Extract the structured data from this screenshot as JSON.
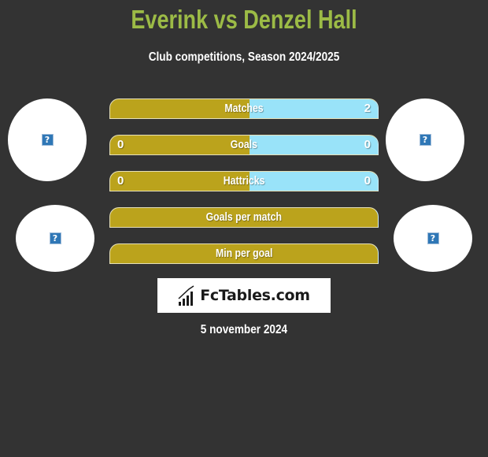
{
  "header": {
    "title": "Everink vs Denzel Hall",
    "subtitle": "Club competitions, Season 2024/2025"
  },
  "colors": {
    "title": "#9cbb46",
    "left_bar": "#bba31c",
    "right_bar": "#99e3f9",
    "background": "#333333"
  },
  "players": {
    "left": {
      "name": "Everink",
      "avatar_icon": "image-placeholder-icon",
      "club_icon": "image-placeholder-icon"
    },
    "right": {
      "name": "Denzel Hall",
      "avatar_icon": "image-placeholder-icon",
      "club_icon": "image-placeholder-icon"
    }
  },
  "stats": [
    {
      "label": "Matches",
      "left": "",
      "right": "2",
      "right_share": 0.48
    },
    {
      "label": "Goals",
      "left": "0",
      "right": "0",
      "right_share": 0.48
    },
    {
      "label": "Hattricks",
      "left": "0",
      "right": "0",
      "right_share": 0.48
    },
    {
      "label": "Goals per match",
      "left": "",
      "right": "",
      "right_share": 0
    },
    {
      "label": "Min per goal",
      "left": "",
      "right": "",
      "right_share": 0
    }
  ],
  "logo": {
    "text": "FcTables.com",
    "icon": "bar-chart-icon"
  },
  "date": "5 november 2024"
}
